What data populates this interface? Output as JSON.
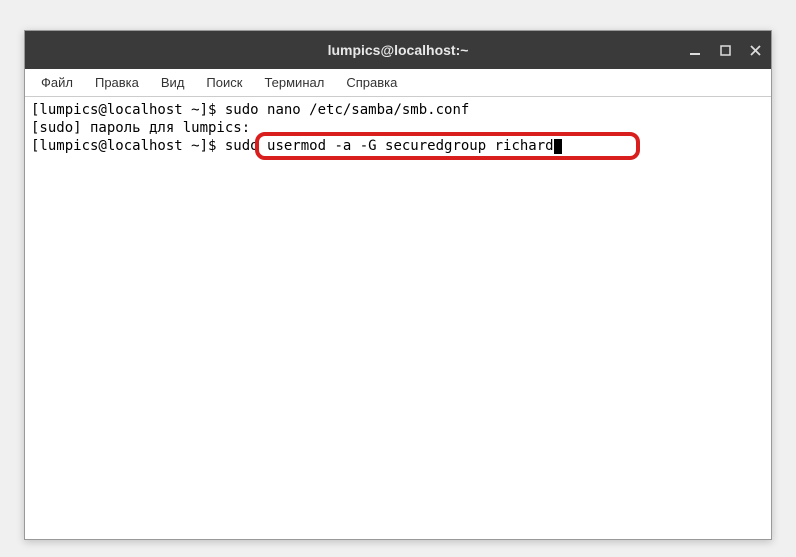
{
  "window": {
    "title": "lumpics@localhost:~"
  },
  "menubar": {
    "items": [
      {
        "label": "Файл"
      },
      {
        "label": "Правка"
      },
      {
        "label": "Вид"
      },
      {
        "label": "Поиск"
      },
      {
        "label": "Терминал"
      },
      {
        "label": "Справка"
      }
    ]
  },
  "terminal": {
    "line1_prompt": "[lumpics@localhost ~]$ ",
    "line1_cmd": "sudo nano /etc/samba/smb.conf",
    "line2": "[sudo] пароль для lumpics:",
    "line3_prompt": "[lumpics@localhost ~]$ ",
    "line3_cmd": "sudo usermod -a -G securedgroup richard"
  },
  "controls": {
    "minimize": "—",
    "maximize": "□",
    "close": "✕"
  }
}
